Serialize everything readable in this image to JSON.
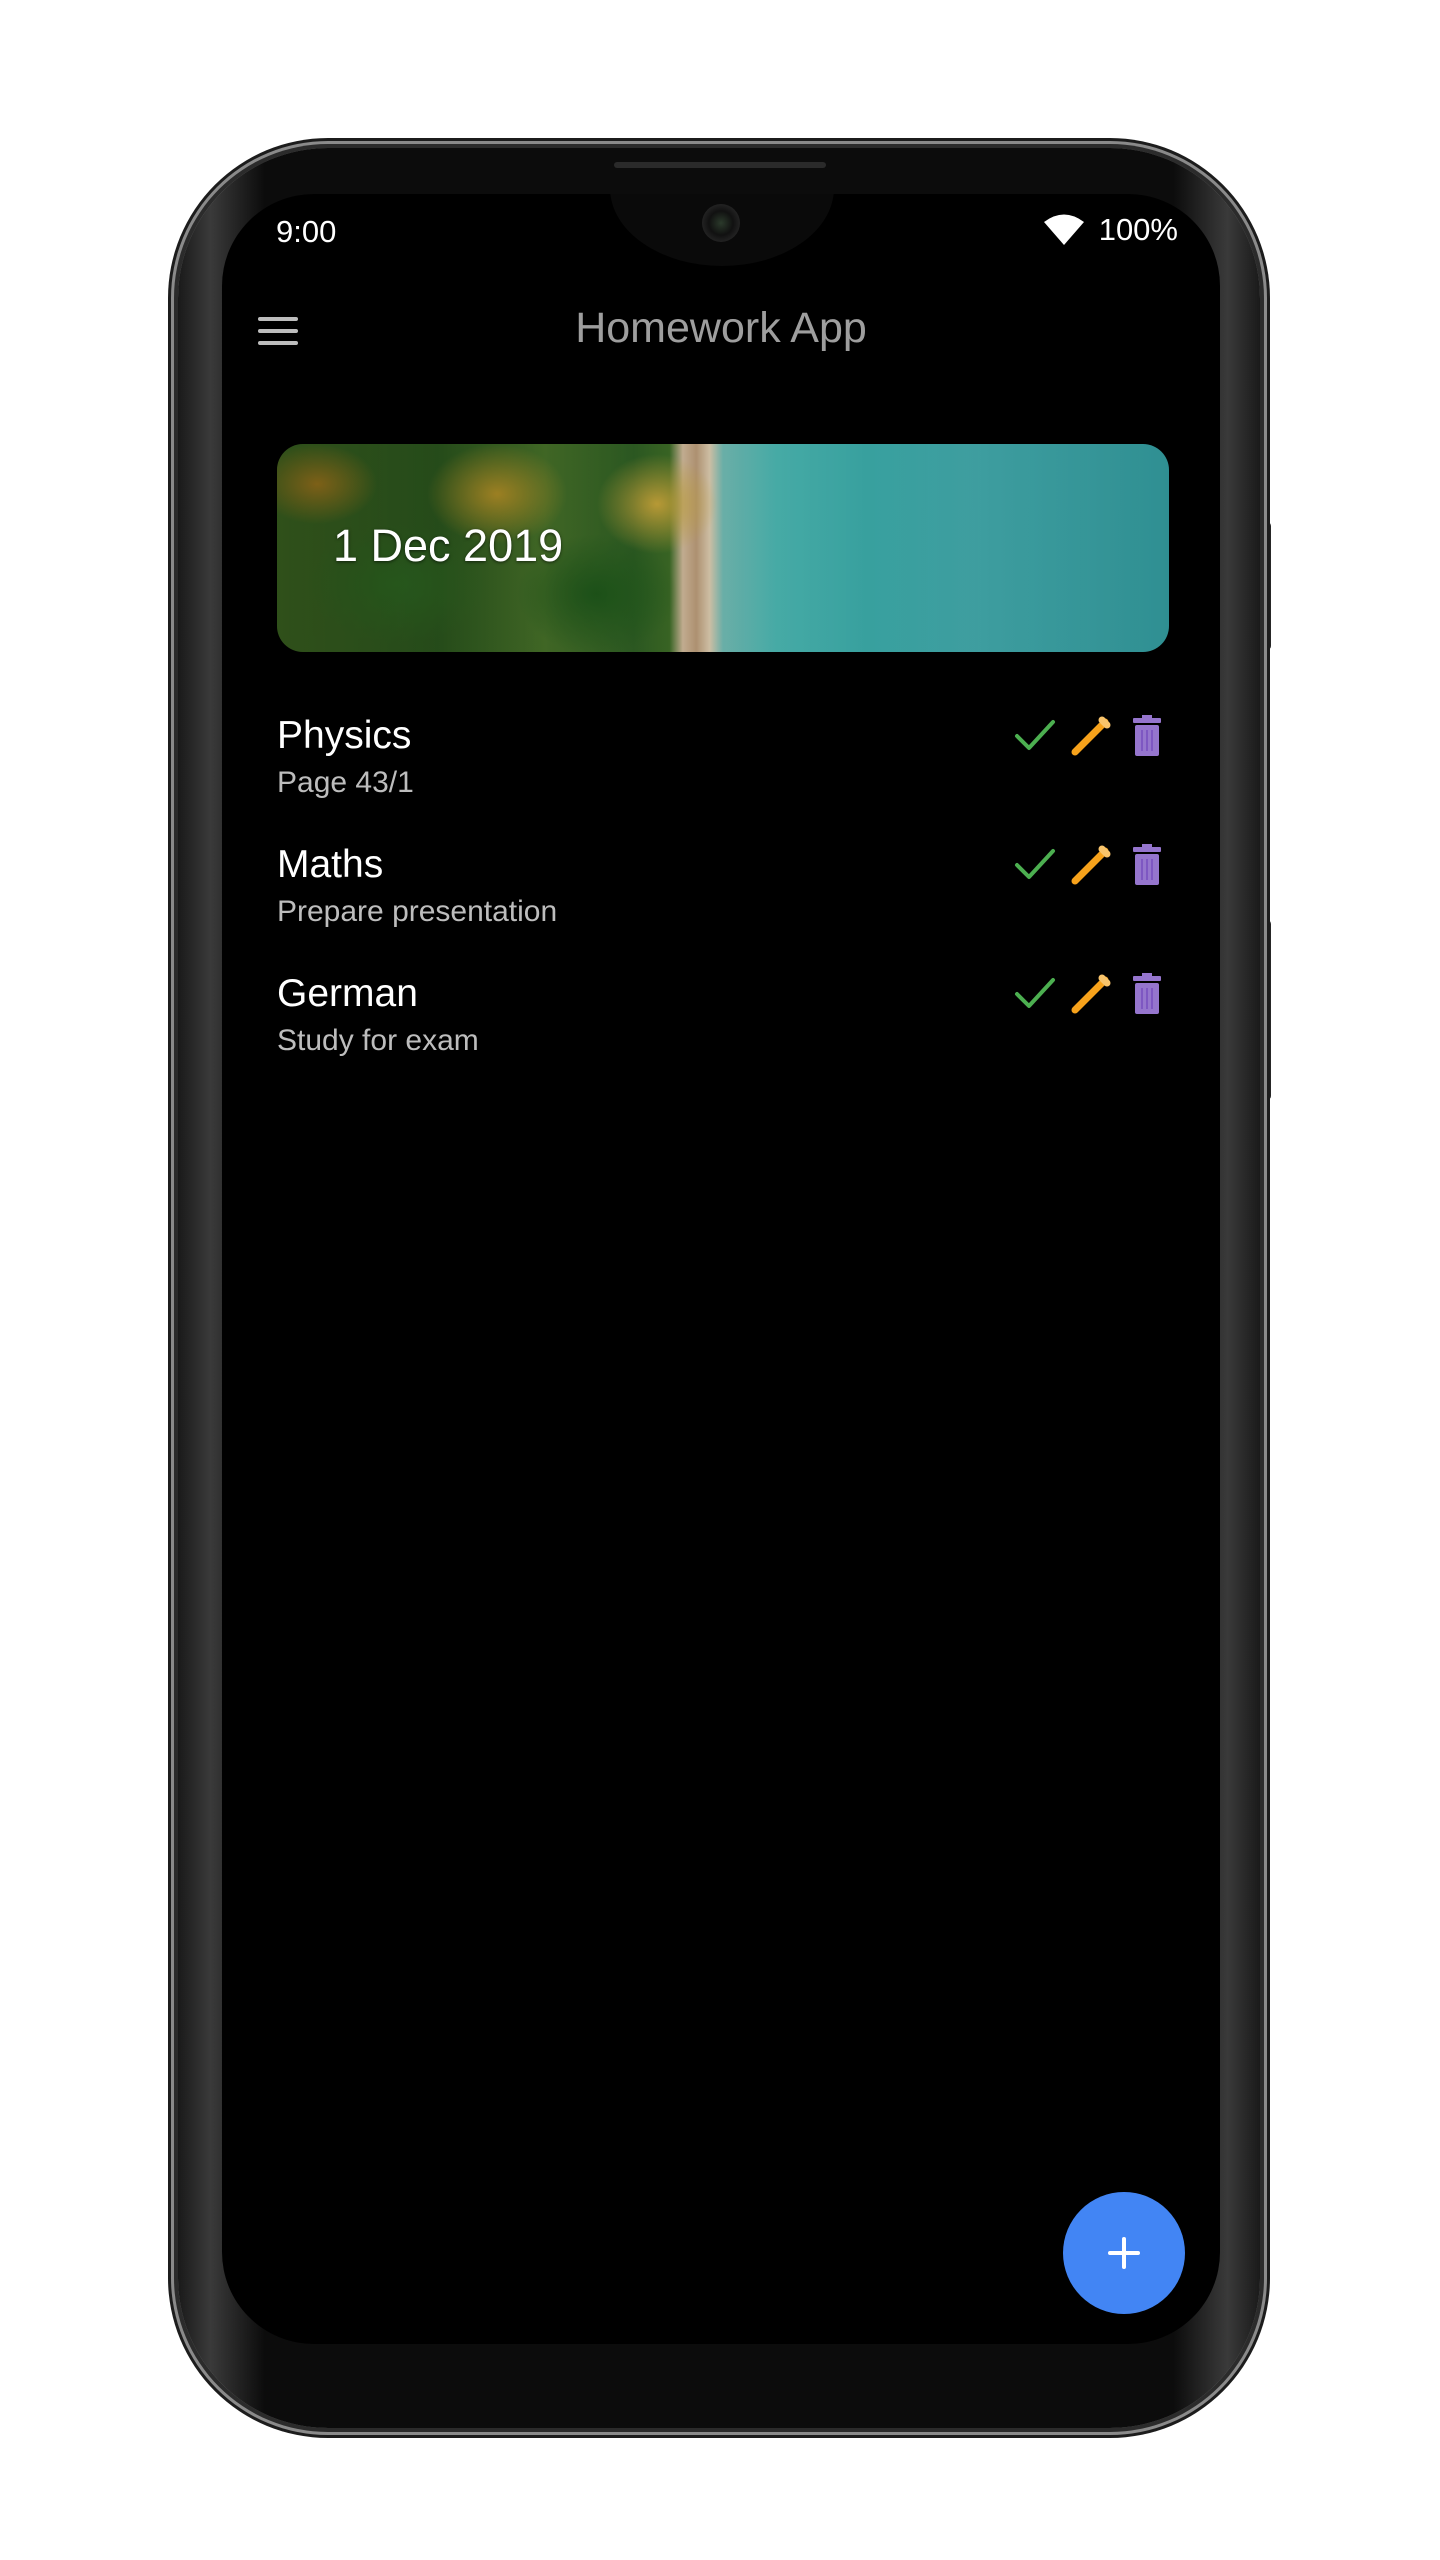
{
  "status_bar": {
    "time": "9:00",
    "battery": "100%",
    "wifi_icon": "wifi-icon"
  },
  "app_bar": {
    "title": "Homework App",
    "menu_icon": "menu-icon"
  },
  "banner": {
    "date": "1 Dec 2019"
  },
  "homework": [
    {
      "subject": "Physics",
      "task": "Page 43/1"
    },
    {
      "subject": "Maths",
      "task": "Prepare presentation"
    },
    {
      "subject": "German",
      "task": "Study for exam"
    }
  ],
  "actions": {
    "done_icon": "check-icon",
    "edit_icon": "pencil-icon",
    "delete_icon": "trash-icon"
  },
  "fab": {
    "icon": "plus-icon"
  },
  "colors": {
    "background": "#000000",
    "title": "#9e9e9e",
    "check": "#4caf50",
    "pencil": "#f7a21b",
    "trash": "#9575cd",
    "fab": "#4285f4"
  }
}
